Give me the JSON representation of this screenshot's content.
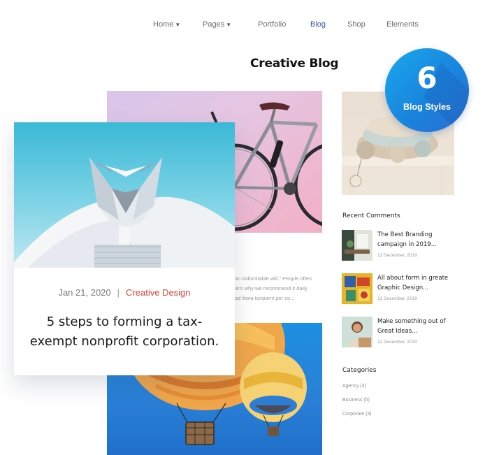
{
  "nav": {
    "items": [
      {
        "label": "Home",
        "has_dropdown": true
      },
      {
        "label": "Pages",
        "has_dropdown": true
      },
      {
        "label": "Portfolio",
        "has_dropdown": false
      },
      {
        "label": "Blog",
        "has_dropdown": false,
        "active": true
      },
      {
        "label": "Shop",
        "has_dropdown": false
      },
      {
        "label": "Elements",
        "has_dropdown": false
      }
    ],
    "dropdown_icon": "chevron-down-icon",
    "active_color": "#3a56c4"
  },
  "page": {
    "title": "Creative Blog"
  },
  "badge": {
    "number": "6",
    "label": "Blog Styles",
    "color": "#1a8fe3"
  },
  "featured_post": {
    "date": "Jan 21, 2020",
    "separator": "|",
    "category": "Creative Design",
    "category_color": "#e0473f",
    "title": "5 steps to forming a tax-exempt nonprofit corporation."
  },
  "background_post": {
    "excerpt_lines": [
      "an indomitable will.” People often",
      "at’s why we recommend it daily.",
      "ad litora torquent per co..."
    ]
  },
  "sidebar": {
    "recent_comments": {
      "heading": "Recent Comments",
      "items": [
        {
          "title": "The Best Branding campaign in 2019...",
          "date": "12 December, 2019"
        },
        {
          "title": "All about form in greate Graphic Design...",
          "date": "12 December, 2019"
        },
        {
          "title": "Make something out of Great Ideas...",
          "date": "12 December, 2019"
        }
      ]
    },
    "categories": {
      "heading": "Categories",
      "items": [
        "Agency (4)",
        "Business (5)",
        "Corporate (3)"
      ]
    }
  }
}
